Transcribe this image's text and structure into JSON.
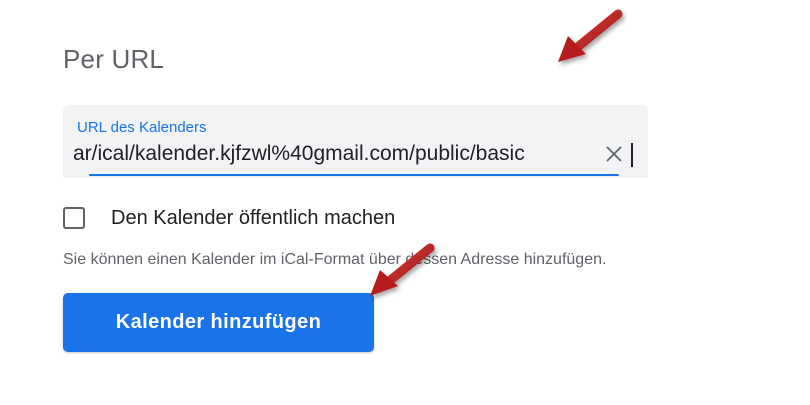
{
  "section": {
    "title": "Per URL"
  },
  "url_field": {
    "label": "URL des Kalenders",
    "value": "ar/ical/kalender.kjfzwl%40gmail.com/public/basic"
  },
  "public_option": {
    "label": "Den Kalender öffentlich machen",
    "checked": false
  },
  "help_text": "Sie können einen Kalender im iCal-Format über dessen Adresse hinzufügen.",
  "add_button": {
    "label": "Kalender hinzufügen"
  },
  "colors": {
    "accent": "#1a73e8",
    "annotation_arrow": "#c62828"
  },
  "icons": [
    "clear-icon",
    "annotation-arrow-icon"
  ]
}
